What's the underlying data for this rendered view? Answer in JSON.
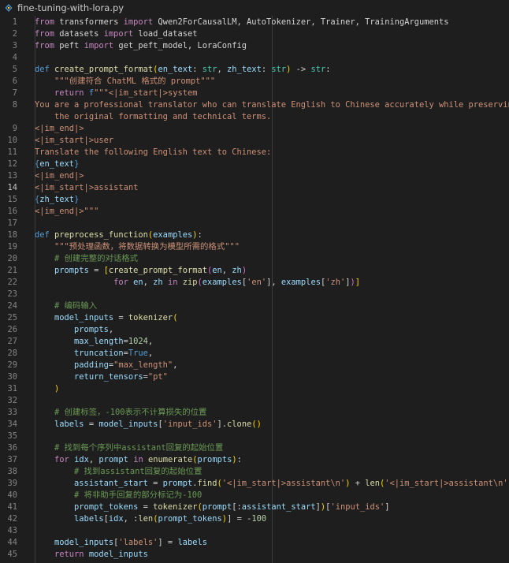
{
  "tab": {
    "file_name": "fine-tuning-with-lora.py",
    "icon": "python-file-icon"
  },
  "editor": {
    "active_line": 14,
    "colors": {
      "background": "#1e1e1e",
      "keyword": "#c586c0",
      "storage": "#569cd6",
      "function": "#dcdcaa",
      "string": "#ce9178",
      "number": "#b5cea8",
      "parameter": "#9cdcfe",
      "type": "#4ec9b0",
      "comment": "#6a9955",
      "bracket": "#ffd700"
    },
    "lines": [
      {
        "n": "1",
        "t": [
          [
            "kw",
            "from"
          ],
          [
            "tx",
            " transformers "
          ],
          [
            "kw",
            "import"
          ],
          [
            "tx",
            " Qwen2ForCausalLM, AutoTokenizer, Trainer, TrainingArguments"
          ]
        ]
      },
      {
        "n": "2",
        "t": [
          [
            "kw",
            "from"
          ],
          [
            "tx",
            " datasets "
          ],
          [
            "kw",
            "import"
          ],
          [
            "tx",
            " load_dataset"
          ]
        ]
      },
      {
        "n": "3",
        "t": [
          [
            "kw",
            "from"
          ],
          [
            "tx",
            " peft "
          ],
          [
            "kw",
            "import"
          ],
          [
            "tx",
            " get_peft_model, LoraConfig"
          ]
        ]
      },
      {
        "n": "4",
        "t": []
      },
      {
        "n": "5",
        "t": [
          [
            "st",
            "def"
          ],
          [
            "tx",
            " "
          ],
          [
            "fn",
            "create_prompt_format"
          ],
          [
            "br",
            "("
          ],
          [
            "prm",
            "en_text"
          ],
          [
            "tx",
            ": "
          ],
          [
            "ty",
            "str"
          ],
          [
            "tx",
            ", "
          ],
          [
            "prm",
            "zh_text"
          ],
          [
            "tx",
            ": "
          ],
          [
            "ty",
            "str"
          ],
          [
            "br",
            ")"
          ],
          [
            "tx",
            " -> "
          ],
          [
            "ty",
            "str"
          ],
          [
            "tx",
            ":"
          ]
        ]
      },
      {
        "n": "6",
        "t": [
          [
            "tx",
            "    "
          ],
          [
            "str",
            "\"\"\"创建符合 ChatML 格式的 prompt\"\"\""
          ]
        ]
      },
      {
        "n": "7",
        "t": [
          [
            "tx",
            "    "
          ],
          [
            "kw",
            "return"
          ],
          [
            "tx",
            " "
          ],
          [
            "st",
            "f"
          ],
          [
            "str",
            "\"\"\"<|im_start|>system"
          ]
        ]
      },
      {
        "n": "8",
        "t": [
          [
            "str",
            "You are a professional translator who can translate English to Chinese accurately while preserving"
          ]
        ]
      },
      {
        "n": "",
        "t": [
          [
            "str",
            "    the original formatting and technical terms."
          ]
        ]
      },
      {
        "n": "9",
        "t": [
          [
            "str",
            "<|im_end|>"
          ]
        ]
      },
      {
        "n": "10",
        "t": [
          [
            "str",
            "<|im_start|>user"
          ]
        ]
      },
      {
        "n": "11",
        "t": [
          [
            "str",
            "Translate the following English text to Chinese:"
          ]
        ]
      },
      {
        "n": "12",
        "t": [
          [
            "st",
            "{"
          ],
          [
            "prm",
            "en_text"
          ],
          [
            "st",
            "}"
          ]
        ]
      },
      {
        "n": "13",
        "t": [
          [
            "str",
            "<|im_end|>"
          ]
        ]
      },
      {
        "n": "14",
        "t": [
          [
            "str",
            "<|im_start|>assistant"
          ]
        ]
      },
      {
        "n": "15",
        "t": [
          [
            "st",
            "{"
          ],
          [
            "prm",
            "zh_text"
          ],
          [
            "st",
            "}"
          ]
        ]
      },
      {
        "n": "16",
        "t": [
          [
            "str",
            "<|im_end|>\"\"\""
          ]
        ]
      },
      {
        "n": "17",
        "t": []
      },
      {
        "n": "18",
        "t": [
          [
            "st",
            "def"
          ],
          [
            "tx",
            " "
          ],
          [
            "fn",
            "preprocess_function"
          ],
          [
            "br",
            "("
          ],
          [
            "prm",
            "examples"
          ],
          [
            "br",
            ")"
          ],
          [
            "tx",
            ":"
          ]
        ]
      },
      {
        "n": "19",
        "t": [
          [
            "tx",
            "    "
          ],
          [
            "str",
            "\"\"\"预处理函数，将数据转换为模型所需的格式\"\"\""
          ]
        ]
      },
      {
        "n": "20",
        "t": [
          [
            "tx",
            "    "
          ],
          [
            "cm",
            "# 创建完整的对话格式"
          ]
        ]
      },
      {
        "n": "21",
        "t": [
          [
            "tx",
            "    "
          ],
          [
            "prm",
            "prompts"
          ],
          [
            "tx",
            " = "
          ],
          [
            "br",
            "["
          ],
          [
            "fn",
            "create_prompt_format"
          ],
          [
            "br2",
            "("
          ],
          [
            "prm",
            "en"
          ],
          [
            "tx",
            ", "
          ],
          [
            "prm",
            "zh"
          ],
          [
            "br2",
            ")"
          ]
        ]
      },
      {
        "n": "22",
        "t": [
          [
            "tx",
            "                "
          ],
          [
            "kw",
            "for"
          ],
          [
            "tx",
            " "
          ],
          [
            "prm",
            "en"
          ],
          [
            "tx",
            ", "
          ],
          [
            "prm",
            "zh"
          ],
          [
            "tx",
            " "
          ],
          [
            "kw",
            "in"
          ],
          [
            "tx",
            " "
          ],
          [
            "fn",
            "zip"
          ],
          [
            "br2",
            "("
          ],
          [
            "prm",
            "examples"
          ],
          [
            "tx",
            "["
          ],
          [
            "str",
            "'en'"
          ],
          [
            "tx",
            "], "
          ],
          [
            "prm",
            "examples"
          ],
          [
            "tx",
            "["
          ],
          [
            "str",
            "'zh'"
          ],
          [
            "tx",
            "]"
          ],
          [
            "br2",
            ")"
          ],
          [
            "br",
            "]"
          ]
        ]
      },
      {
        "n": "23",
        "t": []
      },
      {
        "n": "24",
        "t": [
          [
            "tx",
            "    "
          ],
          [
            "cm",
            "# 编码输入"
          ]
        ]
      },
      {
        "n": "25",
        "t": [
          [
            "tx",
            "    "
          ],
          [
            "prm",
            "model_inputs"
          ],
          [
            "tx",
            " = "
          ],
          [
            "fn",
            "tokenizer"
          ],
          [
            "br",
            "("
          ]
        ]
      },
      {
        "n": "26",
        "t": [
          [
            "tx",
            "        "
          ],
          [
            "prm",
            "prompts"
          ],
          [
            "tx",
            ","
          ]
        ]
      },
      {
        "n": "27",
        "t": [
          [
            "tx",
            "        "
          ],
          [
            "prm",
            "max_length"
          ],
          [
            "tx",
            "="
          ],
          [
            "num",
            "1024"
          ],
          [
            "tx",
            ","
          ]
        ]
      },
      {
        "n": "28",
        "t": [
          [
            "tx",
            "        "
          ],
          [
            "prm",
            "truncation"
          ],
          [
            "tx",
            "="
          ],
          [
            "st",
            "True"
          ],
          [
            "tx",
            ","
          ]
        ]
      },
      {
        "n": "29",
        "t": [
          [
            "tx",
            "        "
          ],
          [
            "prm",
            "padding"
          ],
          [
            "tx",
            "="
          ],
          [
            "str",
            "\"max_length\""
          ],
          [
            "tx",
            ","
          ]
        ]
      },
      {
        "n": "30",
        "t": [
          [
            "tx",
            "        "
          ],
          [
            "prm",
            "return_tensors"
          ],
          [
            "tx",
            "="
          ],
          [
            "str",
            "\"pt\""
          ]
        ]
      },
      {
        "n": "31",
        "t": [
          [
            "tx",
            "    "
          ],
          [
            "br",
            ")"
          ]
        ]
      },
      {
        "n": "32",
        "t": []
      },
      {
        "n": "33",
        "t": [
          [
            "tx",
            "    "
          ],
          [
            "cm",
            "# 创建标签，-100表示不计算损失的位置"
          ]
        ]
      },
      {
        "n": "34",
        "t": [
          [
            "tx",
            "    "
          ],
          [
            "prm",
            "labels"
          ],
          [
            "tx",
            " = "
          ],
          [
            "prm",
            "model_inputs"
          ],
          [
            "tx",
            "["
          ],
          [
            "str",
            "'input_ids'"
          ],
          [
            "tx",
            "]."
          ],
          [
            "fn",
            "clone"
          ],
          [
            "br",
            "()"
          ]
        ]
      },
      {
        "n": "35",
        "t": []
      },
      {
        "n": "36",
        "t": [
          [
            "tx",
            "    "
          ],
          [
            "cm",
            "# 找到每个序列中assistant回复的起始位置"
          ]
        ]
      },
      {
        "n": "37",
        "t": [
          [
            "tx",
            "    "
          ],
          [
            "kw",
            "for"
          ],
          [
            "tx",
            " "
          ],
          [
            "prm",
            "idx"
          ],
          [
            "tx",
            ", "
          ],
          [
            "prm",
            "prompt"
          ],
          [
            "tx",
            " "
          ],
          [
            "kw",
            "in"
          ],
          [
            "tx",
            " "
          ],
          [
            "fn",
            "enumerate"
          ],
          [
            "br",
            "("
          ],
          [
            "prm",
            "prompts"
          ],
          [
            "br",
            ")"
          ],
          [
            "tx",
            ":"
          ]
        ]
      },
      {
        "n": "38",
        "t": [
          [
            "tx",
            "        "
          ],
          [
            "cm",
            "# 找到assistant回复的起始位置"
          ]
        ]
      },
      {
        "n": "39",
        "t": [
          [
            "tx",
            "        "
          ],
          [
            "prm",
            "assistant_start"
          ],
          [
            "tx",
            " = "
          ],
          [
            "prm",
            "prompt"
          ],
          [
            "tx",
            "."
          ],
          [
            "fn",
            "find"
          ],
          [
            "br",
            "("
          ],
          [
            "str",
            "'<|im_start|>assistant\\n'"
          ],
          [
            "br",
            ")"
          ],
          [
            "tx",
            " + "
          ],
          [
            "fn",
            "len"
          ],
          [
            "br",
            "("
          ],
          [
            "str",
            "'<|im_start|>assistant\\n'"
          ],
          [
            "br",
            ")"
          ]
        ]
      },
      {
        "n": "40",
        "t": [
          [
            "tx",
            "        "
          ],
          [
            "cm",
            "# 将非助手回复的部分标记为-100"
          ]
        ]
      },
      {
        "n": "41",
        "t": [
          [
            "tx",
            "        "
          ],
          [
            "prm",
            "prompt_tokens"
          ],
          [
            "tx",
            " = "
          ],
          [
            "fn",
            "tokenizer"
          ],
          [
            "br",
            "("
          ],
          [
            "prm",
            "prompt"
          ],
          [
            "tx",
            "[:"
          ],
          [
            "prm",
            "assistant_start"
          ],
          [
            "tx",
            "]"
          ],
          [
            "br",
            ")"
          ],
          [
            "tx",
            "["
          ],
          [
            "str",
            "'input_ids'"
          ],
          [
            "tx",
            "]"
          ]
        ]
      },
      {
        "n": "42",
        "t": [
          [
            "tx",
            "        "
          ],
          [
            "prm",
            "labels"
          ],
          [
            "tx",
            "["
          ],
          [
            "prm",
            "idx"
          ],
          [
            "tx",
            ", :"
          ],
          [
            "fn",
            "len"
          ],
          [
            "br",
            "("
          ],
          [
            "prm",
            "prompt_tokens"
          ],
          [
            "br",
            ")"
          ],
          [
            "tx",
            "] = -"
          ],
          [
            "num",
            "100"
          ]
        ]
      },
      {
        "n": "43",
        "t": []
      },
      {
        "n": "44",
        "t": [
          [
            "tx",
            "    "
          ],
          [
            "prm",
            "model_inputs"
          ],
          [
            "tx",
            "["
          ],
          [
            "str",
            "'labels'"
          ],
          [
            "tx",
            "] = "
          ],
          [
            "prm",
            "labels"
          ]
        ]
      },
      {
        "n": "45",
        "t": [
          [
            "tx",
            "    "
          ],
          [
            "kw",
            "return"
          ],
          [
            "tx",
            " "
          ],
          [
            "prm",
            "model_inputs"
          ]
        ]
      }
    ]
  }
}
